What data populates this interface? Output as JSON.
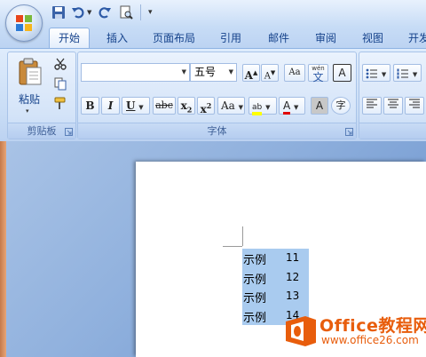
{
  "quick_access": {
    "save_icon": "save-icon",
    "undo_icon": "undo-icon",
    "redo_icon": "redo-icon",
    "print_preview_icon": "print-preview-icon",
    "customize_icon": "customize-toolbar-icon"
  },
  "tabs": [
    {
      "label": "开始",
      "active": true
    },
    {
      "label": "插入"
    },
    {
      "label": "页面布局"
    },
    {
      "label": "引用"
    },
    {
      "label": "邮件"
    },
    {
      "label": "审阅"
    },
    {
      "label": "视图"
    },
    {
      "label": "开发"
    }
  ],
  "clipboard": {
    "group_label": "剪贴板",
    "paste_label": "粘贴",
    "cut_icon": "scissors-icon",
    "copy_icon": "copy-icon",
    "format_painter_icon": "format-painter-icon"
  },
  "font": {
    "group_label": "字体",
    "font_name_value": "",
    "font_size_value": "五号",
    "grow_label": "A",
    "shrink_label": "A",
    "clear_format_label": "Aa",
    "phonetic_label": "wén",
    "phonetic_char": "文",
    "border_char": "A",
    "bold_label": "B",
    "italic_label": "I",
    "underline_label": "U",
    "strike_label": "abc",
    "subscript_label": "x",
    "subscript_sub": "2",
    "superscript_label": "x",
    "superscript_sup": "2",
    "case_label": "Aa",
    "highlight_label": "ab",
    "font_color_label": "A",
    "shading_char": "A",
    "enclose_char": "字"
  },
  "paragraph": {
    "bullets_icon": "bullets-icon",
    "numbering_icon": "numbering-icon",
    "align_left_icon": "align-left-icon",
    "center_icon": "center-icon",
    "align_right_icon": "align-right-icon"
  },
  "document": {
    "lines": [
      {
        "text": "示例",
        "number": "11"
      },
      {
        "text": "示例",
        "number": "12"
      },
      {
        "text": "示例",
        "number": "13"
      },
      {
        "text": "示例",
        "number": "14"
      }
    ]
  },
  "watermark": {
    "title": "Office教程网",
    "url": "www.office26.com"
  },
  "colors": {
    "ribbon_blue": "#15428b",
    "selection": "#a9cbef",
    "font_color_red": "#e00000",
    "highlight_yellow": "#ffff00",
    "watermark_orange": "#e85d0c"
  }
}
